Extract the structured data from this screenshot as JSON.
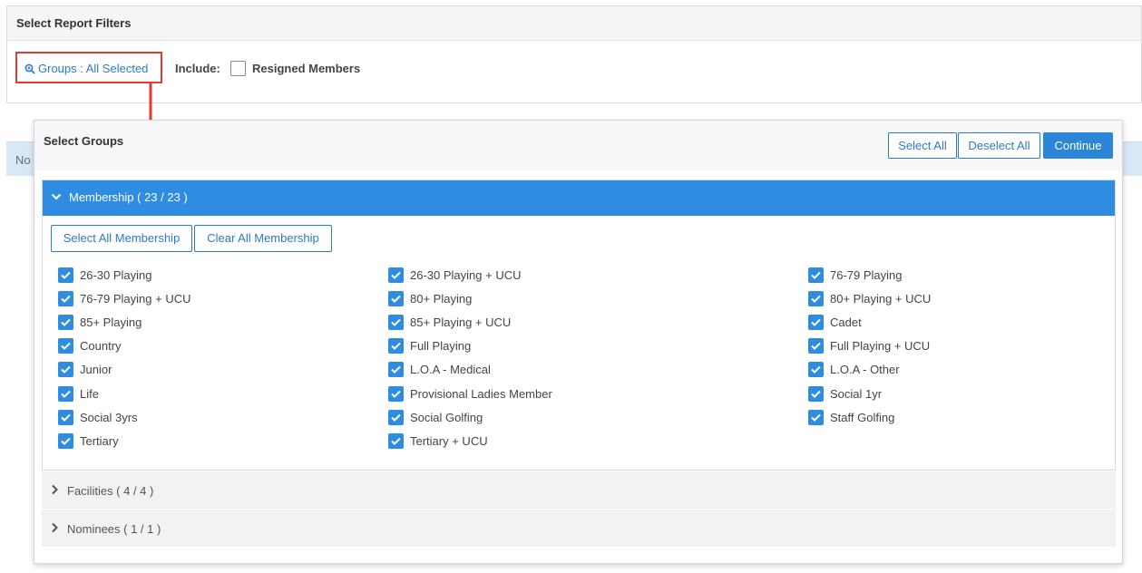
{
  "filters": {
    "title": "Select Report Filters",
    "groups_link": "Groups : All Selected",
    "include_label": "Include:",
    "resigned_label": "Resigned Members"
  },
  "results": {
    "text": "No"
  },
  "popup": {
    "title": "Select Groups",
    "select_all": "Select All",
    "deselect_all": "Deselect All",
    "continue": "Continue"
  },
  "membership": {
    "header": "Membership ( 23 / 23 )",
    "select_all": "Select All Membership",
    "clear_all": "Clear All Membership",
    "items": [
      "26-30 Playing",
      "26-30 Playing + UCU",
      "76-79 Playing",
      "76-79 Playing + UCU",
      "80+ Playing",
      "80+ Playing + UCU",
      "85+ Playing",
      "85+ Playing + UCU",
      "Cadet",
      "Country",
      "Full Playing",
      "Full Playing + UCU",
      "Junior",
      "L.O.A - Medical",
      "L.O.A - Other",
      "Life",
      "Provisional Ladies Member",
      "Social 1yr",
      "Social 3yrs",
      "Social Golfing",
      "Staff Golfing",
      "Tertiary",
      "Tertiary + UCU"
    ]
  },
  "facilities": {
    "header": "Facilities ( 4 / 4 )"
  },
  "nominees": {
    "header": "Nominees ( 1 / 1 )"
  },
  "colors": {
    "accent": "#2e8de0",
    "link": "#2b7bc4",
    "annotation": "#e53935"
  }
}
